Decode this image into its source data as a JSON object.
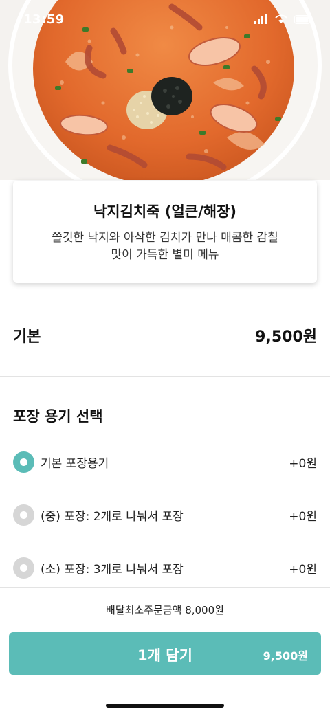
{
  "status_bar": {
    "time": "13:59",
    "icons": [
      "signal-icon",
      "wifi-icon",
      "battery-icon"
    ]
  },
  "hero": {
    "image": "octopus-kimchi-porridge-photo"
  },
  "menu": {
    "title": "낙지김치죽 (얼큰/해장)",
    "description": "쫄깃한 낙지와 아삭한 김치가 만나 매콤한 감칠맛이 가득한 별미 메뉴"
  },
  "base_price": {
    "label": "기본",
    "value": "9,500원"
  },
  "packaging": {
    "title": "포장 용기 선택",
    "options": [
      {
        "label": "기본 포장용기",
        "price": "+0원",
        "selected": true
      },
      {
        "label": "(중) 포장: 2개로 나눠서 포장",
        "price": "+0원",
        "selected": false
      },
      {
        "label": "(소) 포장: 3개로 나눠서 포장",
        "price": "+0원",
        "selected": false
      }
    ]
  },
  "footer": {
    "min_order": "배달최소주문금액 8,000원",
    "cart_button_label": "1개 담기",
    "cart_button_price": "9,500원"
  },
  "colors": {
    "accent": "#5bbcb7",
    "radio_unselected": "#d6d6d6",
    "broth": "#e8773a"
  }
}
